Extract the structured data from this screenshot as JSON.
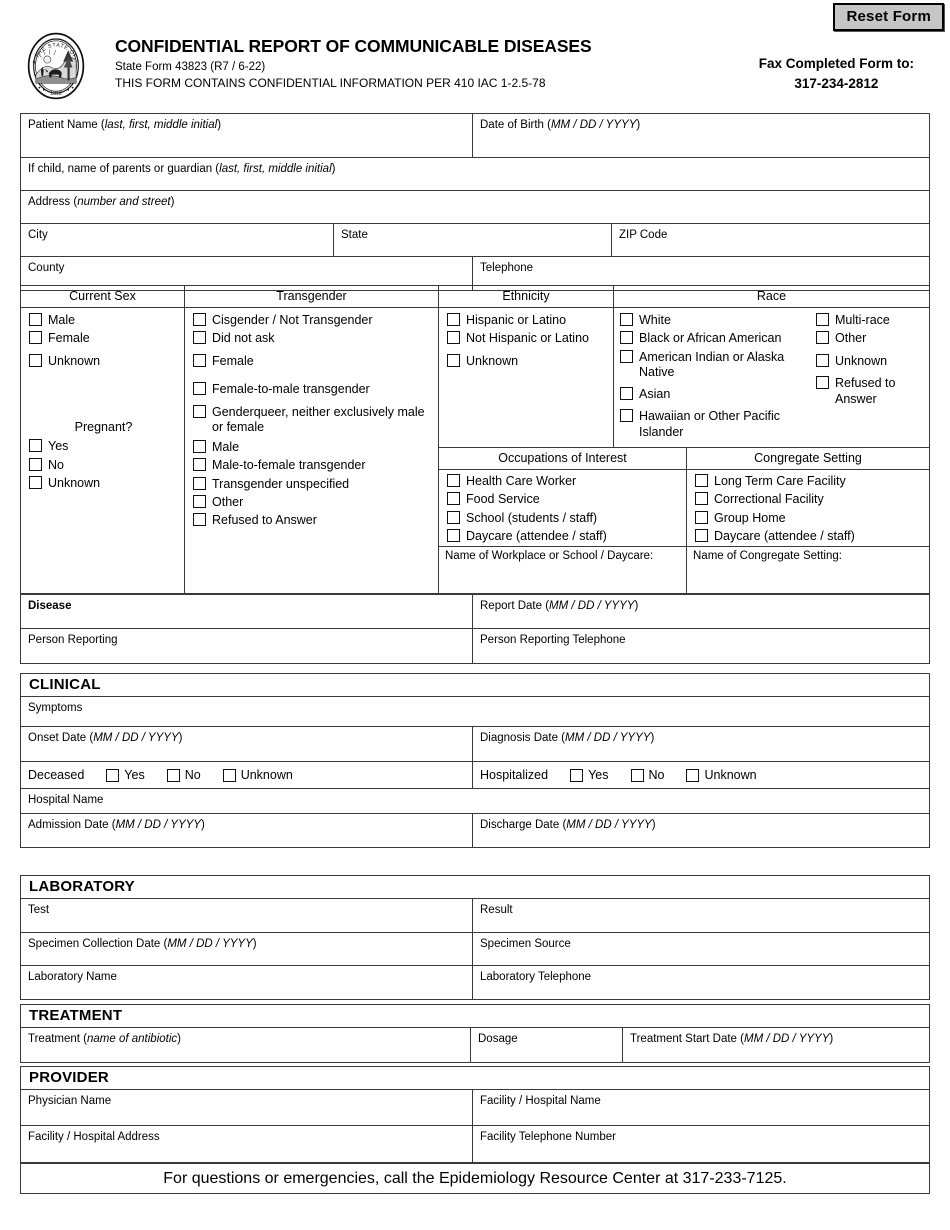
{
  "header": {
    "reset_button": "Reset Form",
    "title": "CONFIDENTIAL REPORT OF COMMUNICABLE DISEASES",
    "state_form": "State Form 43823 (R7 / 6-22)",
    "confidential_notice": "THIS FORM CONTAINS CONFIDENTIAL INFORMATION PER 410 IAC 1-2.5-78",
    "fax_label": "Fax Completed Form to:",
    "fax_number": "317-234-2812",
    "seal_alt": "Seal of the State of Indiana 1816"
  },
  "patient": {
    "name": "Patient Name (",
    "name_italic": "last, first, middle initial",
    "name_end": ")",
    "dob": "Date of Birth (",
    "dob_italic": "MM / DD / YYYY",
    "dob_end": ")",
    "guardian": "If child, name of parents or guardian (",
    "guardian_italic": "last, first, middle initial",
    "guardian_end": ")",
    "address": "Address (",
    "address_italic": "number and street",
    "address_end": ")",
    "city": "City",
    "state": "State",
    "zip": "ZIP Code",
    "county": "County",
    "telephone": "Telephone"
  },
  "demographics": {
    "current_sex": {
      "title": "Current Sex",
      "options": [
        "Male",
        "Female",
        "Unknown"
      ]
    },
    "pregnant": {
      "title": "Pregnant?",
      "options": [
        "Yes",
        "No",
        "Unknown"
      ]
    },
    "transgender": {
      "title": "Transgender",
      "options": [
        "Cisgender / Not Transgender",
        "Did not ask",
        "Female",
        "Female-to-male transgender",
        "Genderqueer, neither exclusively male or female",
        "Male",
        "Male-to-female transgender",
        "Transgender unspecified",
        "Other",
        "Refused to Answer"
      ]
    },
    "ethnicity": {
      "title": "Ethnicity",
      "options": [
        "Hispanic or Latino",
        "Not Hispanic or Latino",
        "Unknown"
      ]
    },
    "race": {
      "title": "Race",
      "column1": [
        "White",
        "Black or African American",
        "American Indian or Alaska Native",
        "Asian",
        "Hawaiian or Other Pacific Islander"
      ],
      "column2": [
        "Multi-race",
        "Other",
        "Unknown",
        "Refused to Answer"
      ]
    },
    "occupations": {
      "title": "Occupations of Interest",
      "options": [
        "Health Care Worker",
        "Food Service",
        "School (students / staff)",
        "Daycare (attendee / staff)"
      ],
      "name_label": "Name of Workplace or School / Daycare:"
    },
    "congregate": {
      "title": "Congregate Setting",
      "options": [
        "Long Term Care Facility",
        "Correctional Facility",
        "Group Home",
        "Daycare (attendee / staff)"
      ],
      "name_label": "Name of Congregate Setting:"
    }
  },
  "disease_block": {
    "disease": "Disease",
    "report_date": "Report Date (",
    "report_date_italic": "MM / DD / YYYY",
    "report_date_end": ")",
    "person_reporting": "Person Reporting",
    "person_reporting_phone": "Person Reporting Telephone"
  },
  "clinical": {
    "heading": "CLINICAL",
    "symptoms": "Symptoms",
    "onset_date": "Onset Date (",
    "onset_date_italic": "MM / DD / YYYY",
    "onset_date_end": ")",
    "diagnosis_date": "Diagnosis Date (",
    "diagnosis_date_italic": "MM / DD / YYYY",
    "diagnosis_date_end": ")",
    "deceased_label": "Deceased",
    "deceased_options": [
      "Yes",
      "No",
      "Unknown"
    ],
    "hospitalized_label": "Hospitalized",
    "hospitalized_options": [
      "Yes",
      "No",
      "Unknown"
    ],
    "hospital_name": "Hospital Name",
    "admission_date": "Admission Date (",
    "admission_date_italic": "MM / DD / YYYY",
    "admission_date_end": ")",
    "discharge_date": "Discharge Date (",
    "discharge_date_italic": "MM / DD / YYYY",
    "discharge_date_end": ")"
  },
  "laboratory": {
    "heading": "LABORATORY",
    "test": "Test",
    "result": "Result",
    "specimen_collection_date": "Specimen Collection Date (",
    "specimen_collection_date_italic": "MM / DD / YYYY",
    "specimen_collection_date_end": ")",
    "specimen_source": "Specimen Source",
    "lab_name": "Laboratory Name",
    "lab_phone": "Laboratory Telephone"
  },
  "treatment": {
    "heading": "TREATMENT",
    "treatment": "Treatment (",
    "treatment_italic": "name of antibiotic",
    "treatment_end": ")",
    "dosage": "Dosage",
    "start_date": "Treatment Start Date (",
    "start_date_italic": "MM / DD / YYYY",
    "start_date_end": ")"
  },
  "provider": {
    "heading": "PROVIDER",
    "physician_name": "Physician Name",
    "facility_name": "Facility / Hospital Name",
    "facility_address": "Facility / Hospital Address",
    "facility_phone": "Facility Telephone Number"
  },
  "footer": {
    "text": "For questions or emergencies, call the Epidemiology Resource Center at 317-233-7125."
  }
}
